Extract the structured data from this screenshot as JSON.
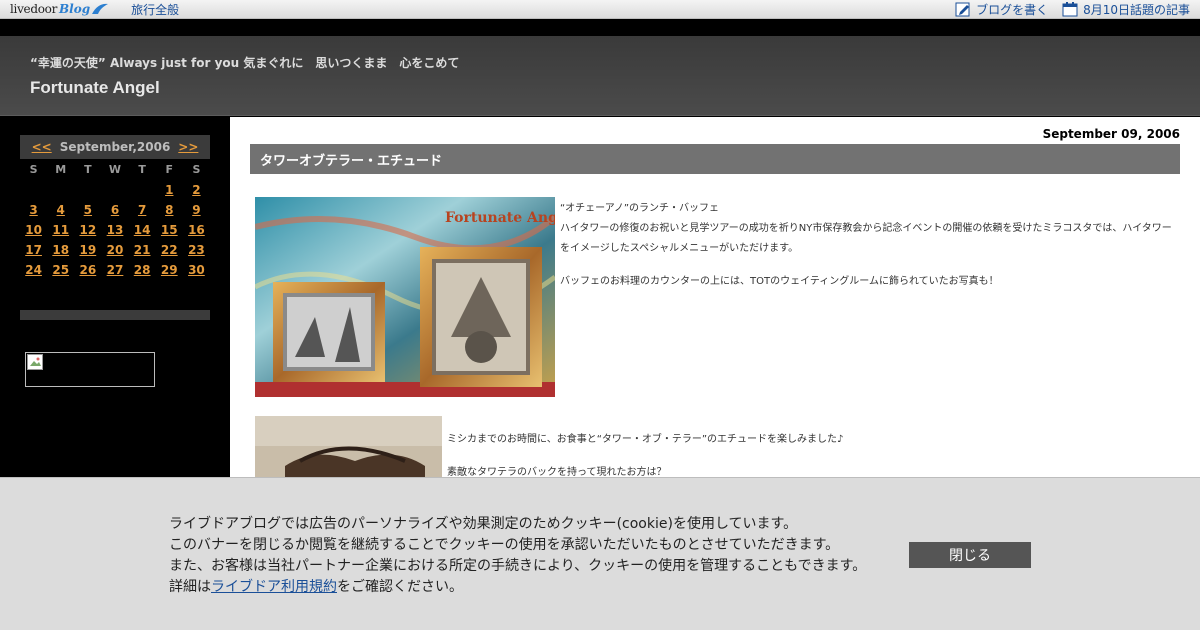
{
  "topbar": {
    "logo_text": "livedoor",
    "logo_blog": "Blog",
    "category": "旅行全般",
    "write_blog": "ブログを書く",
    "topic_articles": "8月10日話題の記事"
  },
  "header": {
    "description": "“幸運の天使” Always just for you 気まぐれに　思いつくまま　心をこめて",
    "title": "Fortunate Angel"
  },
  "calendar": {
    "prev": "<<",
    "month": "September,2006",
    "next": ">>",
    "weekdays": [
      "S",
      "M",
      "T",
      "W",
      "T",
      "F",
      "S"
    ],
    "weeks": [
      [
        "",
        "",
        "",
        "",
        "",
        "1",
        "2"
      ],
      [
        "3",
        "4",
        "5",
        "6",
        "7",
        "8",
        "9"
      ],
      [
        "10",
        "11",
        "12",
        "13",
        "14",
        "15",
        "16"
      ],
      [
        "17",
        "18",
        "19",
        "20",
        "21",
        "22",
        "23"
      ],
      [
        "24",
        "25",
        "26",
        "27",
        "28",
        "29",
        "30"
      ]
    ]
  },
  "post": {
    "date": "September 09, 2006",
    "title": "タワーオブテラー・エチュード",
    "photo1_watermark": "Fortunate Angel",
    "para1_line1": "“オチェーアノ”のランチ・バッフェ",
    "para1_line2": "ハイタワーの修復のお祝いと見学ツアーの成功を祈りNY市保存教会から記念イベントの開催の依頼を受けたミラコスタでは、ハイタワーをイメージしたスペシャルメニューがいただけます。",
    "para2": "バッフェのお料理のカウンターの上には、TOTのウェイティングルームに飾られていたお写真も！",
    "para3": "ミシカまでのお時間に、お食事と“タワー・オブ・テラー”のエチュードを楽しみました♪",
    "para4": "素敵なタワテラのバックを持って現れたお方は？"
  },
  "cookie": {
    "line1": "ライブドアブログでは広告のパーソナライズや効果測定のためクッキー(cookie)を使用しています。",
    "line2": "このバナーを閉じるか閲覧を継続することでクッキーの使用を承認いただいたものとさせていただきます。",
    "line3": "また、お客様は当社パートナー企業における所定の手続きにより、クッキーの使用を管理することもできます。",
    "line4_prefix": "詳細は",
    "line4_link": "ライブドア利用規約",
    "line4_suffix": "をご確認ください。",
    "close_label": "閉じる"
  },
  "colors": {
    "link_orange": "#e59b3c",
    "title_bar": "#727272",
    "header_bg": "#444444",
    "link_blue": "#1a4f98"
  }
}
